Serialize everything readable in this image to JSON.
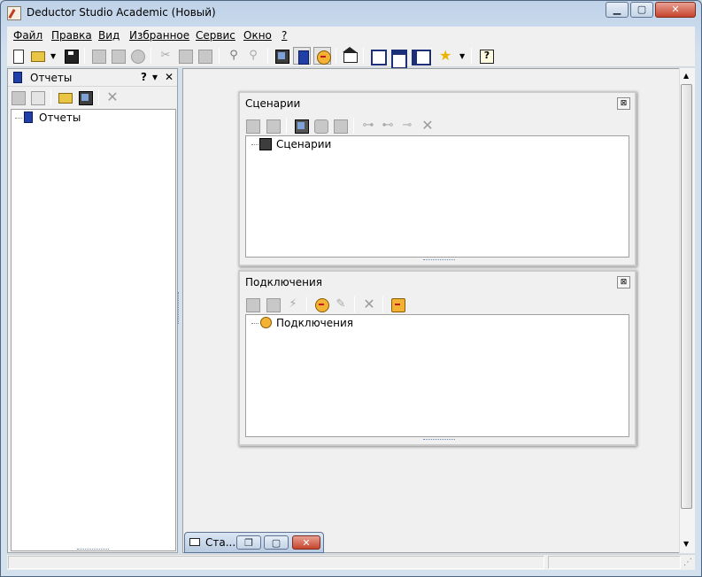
{
  "window": {
    "title": "Deductor Studio Academic (Новый)"
  },
  "menu": [
    "Файл",
    "Правка",
    "Вид",
    "Избранное",
    "Сервис",
    "Окно",
    "?"
  ],
  "left_panel": {
    "title": "Отчеты",
    "help_label": "?",
    "pin_label": "▾",
    "close_label": "✕",
    "tree_root": "Отчеты"
  },
  "scenarios_window": {
    "title": "Сценарии",
    "tree_root": "Сценарии",
    "close_label": "⊠"
  },
  "connections_window": {
    "title": "Подключения",
    "tree_root": "Подключения",
    "close_label": "⊠"
  },
  "taskbar_item": {
    "label": "Ста..."
  },
  "colors": {
    "accent": "#2040a8",
    "close_red": "#c7442c",
    "frame": "#bfd2e8"
  }
}
